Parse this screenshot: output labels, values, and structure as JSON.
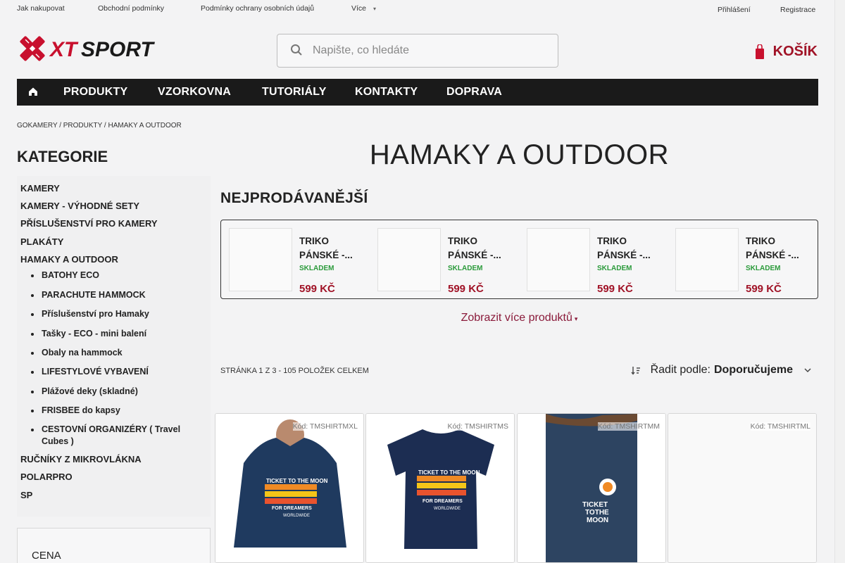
{
  "topbar": {
    "links": [
      "Jak nakupovat",
      "Obchodní podmínky",
      "Podmínky ochrany osobních údajů",
      "Více"
    ],
    "login": "Přihlášení",
    "register": "Registrace"
  },
  "brand": {
    "logo": "XTSPORT",
    "accent": "#a01226"
  },
  "search": {
    "placeholder": "Napište, co hledáte"
  },
  "cart": {
    "label": "KOŠÍK"
  },
  "nav": {
    "items": [
      "PRODUKTY",
      "VZORKOVNA",
      "TUTORIÁLY",
      "KONTAKTY",
      "DOPRAVA"
    ]
  },
  "breadcrumb": "GOKAMERY / PRODUKTY / HAMAKY A OUTDOOR",
  "sidebar": {
    "heading": "KATEGORIE",
    "categories": [
      "KAMERY",
      "KAMERY - VÝHODNÉ SETY",
      "PŘÍSLUŠENSTVÍ PRO KAMERY",
      "PLAKÁTY",
      "HAMAKY A OUTDOOR"
    ],
    "subcategories": [
      "BATOHY ECO",
      "PARACHUTE HAMMOCK",
      "Příslušenství pro Hamaky",
      "Tašky - ECO - mini balení",
      "Obaly na hammock",
      "LIFESTYLOVÉ VYBAVENÍ",
      "Plážové deky (skladné)",
      "FRISBEE do kapsy",
      "CESTOVNÍ ORGANIZÉRY ( Travel Cubes )"
    ],
    "categories_after": [
      "RUČNÍKY Z MIKROVLÁKNA",
      "POLARPRO",
      "SP"
    ],
    "price_label": "CENA"
  },
  "page_title": "HAMAKY A OUTDOOR",
  "bestsellers": {
    "heading": "NEJPRODÁVANĚJŠÍ",
    "items": [
      {
        "name": "TRIKO PÁNSKÉ -...",
        "stock": "SKLADEM",
        "price": "599 KČ"
      },
      {
        "name": "TRIKO PÁNSKÉ -...",
        "stock": "SKLADEM",
        "price": "599 KČ"
      },
      {
        "name": "TRIKO PÁNSKÉ -...",
        "stock": "SKLADEM",
        "price": "599 KČ"
      },
      {
        "name": "TRIKO PÁNSKÉ -...",
        "stock": "SKLADEM",
        "price": "599 KČ"
      }
    ],
    "more": "Zobrazit více produktů"
  },
  "listing": {
    "page_info": "STRÁNKA 1 Z 3 - 105 POLOŽEK CELKEM",
    "sort_label": "Řadit podle:",
    "sort_value": "Doporučujeme",
    "products": [
      {
        "code": "Kód: TMSHIRTMXL"
      },
      {
        "code": "Kód: TMSHIRTMS"
      },
      {
        "code": "Kód: TMSHIRTMM"
      },
      {
        "code": "Kód: TMSHIRTML"
      }
    ],
    "shirt_print": [
      "TICKET TO THE MOON",
      "FOR DREAMERS",
      "WORLDWIDE"
    ]
  }
}
